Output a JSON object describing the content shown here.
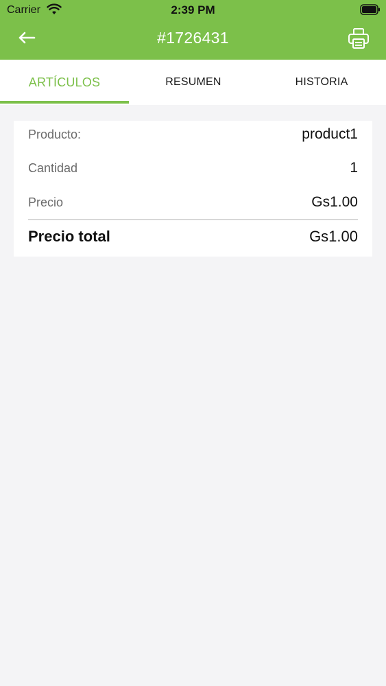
{
  "status_bar": {
    "carrier": "Carrier",
    "time": "2:39 PM",
    "icons": [
      "wifi-icon",
      "battery-icon"
    ]
  },
  "nav": {
    "title": "#1726431",
    "back_icon": "arrow-left-icon",
    "print_icon": "printer-icon"
  },
  "tabs": [
    {
      "label": "ARTÍCULOS",
      "active": true
    },
    {
      "label": "RESUMEN",
      "active": false
    },
    {
      "label": "HISTORIA",
      "active": false
    }
  ],
  "item": {
    "rows": [
      {
        "label": "Producto:",
        "value": "product1"
      },
      {
        "label": "Cantidad",
        "value": "1"
      },
      {
        "label": "Precio",
        "value": "Gs1.00"
      }
    ],
    "total": {
      "label": "Precio total",
      "value": "Gs1.00"
    }
  },
  "colors": {
    "accent": "#7cc04a",
    "background": "#f4f4f6",
    "card": "#ffffff"
  }
}
